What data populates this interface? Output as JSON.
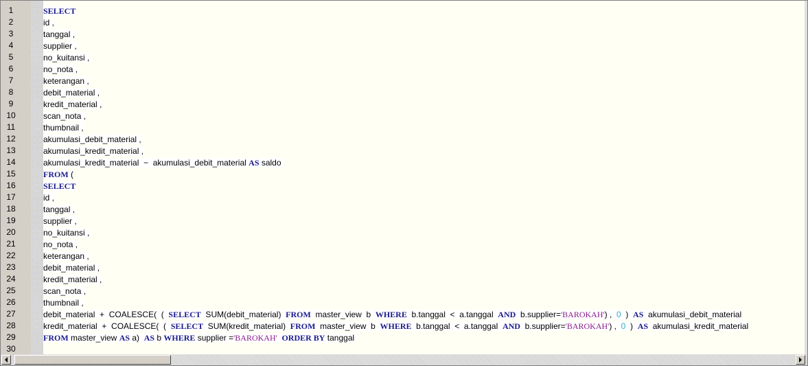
{
  "editor": {
    "lines": [
      [
        [
          "SELECT",
          "kw"
        ]
      ],
      [
        [
          "id ,",
          "id"
        ]
      ],
      [
        [
          "tanggal ,",
          "id"
        ]
      ],
      [
        [
          "supplier ,",
          "id"
        ]
      ],
      [
        [
          "no_kuitansi ,",
          "id"
        ]
      ],
      [
        [
          "no_nota ,",
          "id"
        ]
      ],
      [
        [
          "keterangan ,",
          "id"
        ]
      ],
      [
        [
          "debit_material ,",
          "id"
        ]
      ],
      [
        [
          "kredit_material ,",
          "id"
        ]
      ],
      [
        [
          "scan_nota ,",
          "id"
        ]
      ],
      [
        [
          "thumbnail ,",
          "id"
        ]
      ],
      [
        [
          "akumulasi_debit_material ,",
          "id"
        ]
      ],
      [
        [
          "akumulasi_kredit_material ,",
          "id"
        ]
      ],
      [
        [
          "akumulasi_kredit_material  −  akumulasi_debit_material ",
          "id"
        ],
        [
          "AS",
          "kw"
        ],
        [
          " saldo ",
          "id"
        ]
      ],
      [
        [
          "FROM",
          "kw"
        ],
        [
          " (",
          "id"
        ]
      ],
      [
        [
          "SELECT",
          "kw"
        ]
      ],
      [
        [
          "id ,",
          "id"
        ]
      ],
      [
        [
          "tanggal ,",
          "id"
        ]
      ],
      [
        [
          "supplier ,",
          "id"
        ]
      ],
      [
        [
          "no_kuitansi ,",
          "id"
        ]
      ],
      [
        [
          "no_nota ,",
          "id"
        ]
      ],
      [
        [
          "keterangan ,",
          "id"
        ]
      ],
      [
        [
          "debit_material ,",
          "id"
        ]
      ],
      [
        [
          "kredit_material ,",
          "id"
        ]
      ],
      [
        [
          "scan_nota ,",
          "id"
        ]
      ],
      [
        [
          "thumbnail ,",
          "id"
        ]
      ],
      [
        [
          "debit_material  +  COALESCE(  (  ",
          "id"
        ],
        [
          "SELECT",
          "kw"
        ],
        [
          "  SUM(debit_material)  ",
          "id"
        ],
        [
          "FROM",
          "kw"
        ],
        [
          "  master_view  b  ",
          "id"
        ],
        [
          "WHERE",
          "kw"
        ],
        [
          "  b.tanggal  <  a.tanggal  ",
          "id"
        ],
        [
          "AND",
          "kw"
        ],
        [
          "  b.supplier=",
          "id"
        ],
        [
          "'BAROKAH'",
          "str"
        ],
        [
          ") ,  ",
          "id"
        ],
        [
          "0",
          "num"
        ],
        [
          "  )  ",
          "id"
        ],
        [
          "AS",
          "kw"
        ],
        [
          "  akumulasi_debit_material",
          "id"
        ]
      ],
      [
        [
          "kredit_material  +  COALESCE(  (  ",
          "id"
        ],
        [
          "SELECT",
          "kw"
        ],
        [
          "  SUM(kredit_material)  ",
          "id"
        ],
        [
          "FROM",
          "kw"
        ],
        [
          "  master_view  b  ",
          "id"
        ],
        [
          "WHERE",
          "kw"
        ],
        [
          "  b.tanggal  <  a.tanggal  ",
          "id"
        ],
        [
          "AND",
          "kw"
        ],
        [
          "  b.supplier=",
          "id"
        ],
        [
          "'BAROKAH'",
          "str"
        ],
        [
          ") ,  ",
          "id"
        ],
        [
          "0",
          "num"
        ],
        [
          "  )  ",
          "id"
        ],
        [
          "AS",
          "kw"
        ],
        [
          "  akumulasi_kredit_material",
          "id"
        ]
      ],
      [
        [
          "FROM",
          "kw"
        ],
        [
          " master_view ",
          "id"
        ],
        [
          "AS",
          "kw"
        ],
        [
          " a)  ",
          "id"
        ],
        [
          "AS",
          "kw"
        ],
        [
          " b ",
          "id"
        ],
        [
          "WHERE",
          "kw"
        ],
        [
          " supplier =",
          "id"
        ],
        [
          "'BAROKAH'",
          "str"
        ],
        [
          "  ",
          "id"
        ],
        [
          "ORDER BY",
          "kw"
        ],
        [
          " tanggal ",
          "id"
        ]
      ],
      []
    ]
  },
  "colors": {
    "keyword": "#1a1a8c",
    "string": "#8b1a8b",
    "number": "#33aacc",
    "gutter": "#d4d0c8",
    "background": "#fffff4"
  },
  "icons": {
    "scroll_left": "triangle-left-icon",
    "scroll_right": "triangle-right-icon"
  }
}
